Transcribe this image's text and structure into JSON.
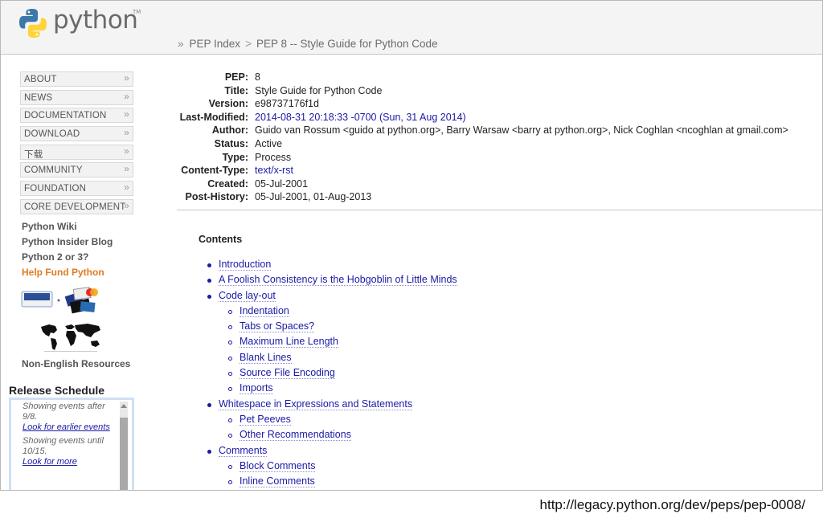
{
  "header": {
    "logo_text": "python",
    "logo_tm": "TM",
    "breadcrumb": {
      "lead": "»",
      "items": [
        "PEP Index",
        "PEP 8 -- Style Guide for Python Code"
      ],
      "separator": ">"
    }
  },
  "nav": {
    "items": [
      {
        "label": "ABOUT"
      },
      {
        "label": "NEWS"
      },
      {
        "label": "DOCUMENTATION"
      },
      {
        "label": "DOWNLOAD"
      },
      {
        "label": "下载"
      },
      {
        "label": "COMMUNITY"
      },
      {
        "label": "FOUNDATION"
      },
      {
        "label": "CORE DEVELOPMENT"
      }
    ],
    "chevron": "»"
  },
  "side_links": {
    "wiki": "Python Wiki",
    "insider": "Python Insider Blog",
    "py2or3": "Python 2 or 3?",
    "fund": "Help Fund Python",
    "non_english": "Non-English Resources"
  },
  "release": {
    "title": "Release Schedule",
    "block1_text": "Showing events after 9/8.",
    "block1_link": "Look for earlier events",
    "block2_text": "Showing events until 10/15.",
    "block2_link": "Look for more"
  },
  "pep": {
    "fields": [
      {
        "k": "PEP:",
        "v": "8"
      },
      {
        "k": "Title:",
        "v": "Style Guide for Python Code"
      },
      {
        "k": "Version:",
        "v": "e98737176f1d"
      },
      {
        "k": "Last-Modified:",
        "v": "2014-08-31 20:18:33 -0700 (Sun, 31 Aug 2014)"
      },
      {
        "k": "Author:",
        "v": "Guido van Rossum <guido at python.org>, Barry Warsaw <barry at python.org>, Nick Coghlan <ncoghlan at gmail.com>"
      },
      {
        "k": "Status:",
        "v": "Active"
      },
      {
        "k": "Type:",
        "v": "Process"
      },
      {
        "k": "Content-Type:",
        "v": "text/x-rst"
      },
      {
        "k": "Created:",
        "v": "05-Jul-2001"
      },
      {
        "k": "Post-History:",
        "v": "05-Jul-2001, 01-Aug-2013"
      }
    ]
  },
  "contents": {
    "title": "Contents",
    "items": [
      {
        "label": "Introduction",
        "level": 1
      },
      {
        "label": "A Foolish Consistency is the Hobgoblin of Little Minds",
        "level": 1
      },
      {
        "label": "Code lay-out",
        "level": 1
      },
      {
        "label": "Indentation",
        "level": 2
      },
      {
        "label": "Tabs or Spaces?",
        "level": 2
      },
      {
        "label": "Maximum Line Length",
        "level": 2
      },
      {
        "label": "Blank Lines",
        "level": 2
      },
      {
        "label": "Source File Encoding",
        "level": 2
      },
      {
        "label": "Imports",
        "level": 2
      },
      {
        "label": "Whitespace in Expressions and Statements",
        "level": 1
      },
      {
        "label": "Pet Peeves",
        "level": 2
      },
      {
        "label": "Other Recommendations",
        "level": 2
      },
      {
        "label": "Comments",
        "level": 1
      },
      {
        "label": "Block Comments",
        "level": 2
      },
      {
        "label": "Inline Comments",
        "level": 2
      }
    ]
  },
  "caption": "http://legacy.python.org/dev/peps/pep-0008/",
  "colors": {
    "link": "#1a1aa6",
    "fund": "#e07b22",
    "python_blue": "#3c78aa",
    "python_yellow": "#ffd43b"
  }
}
